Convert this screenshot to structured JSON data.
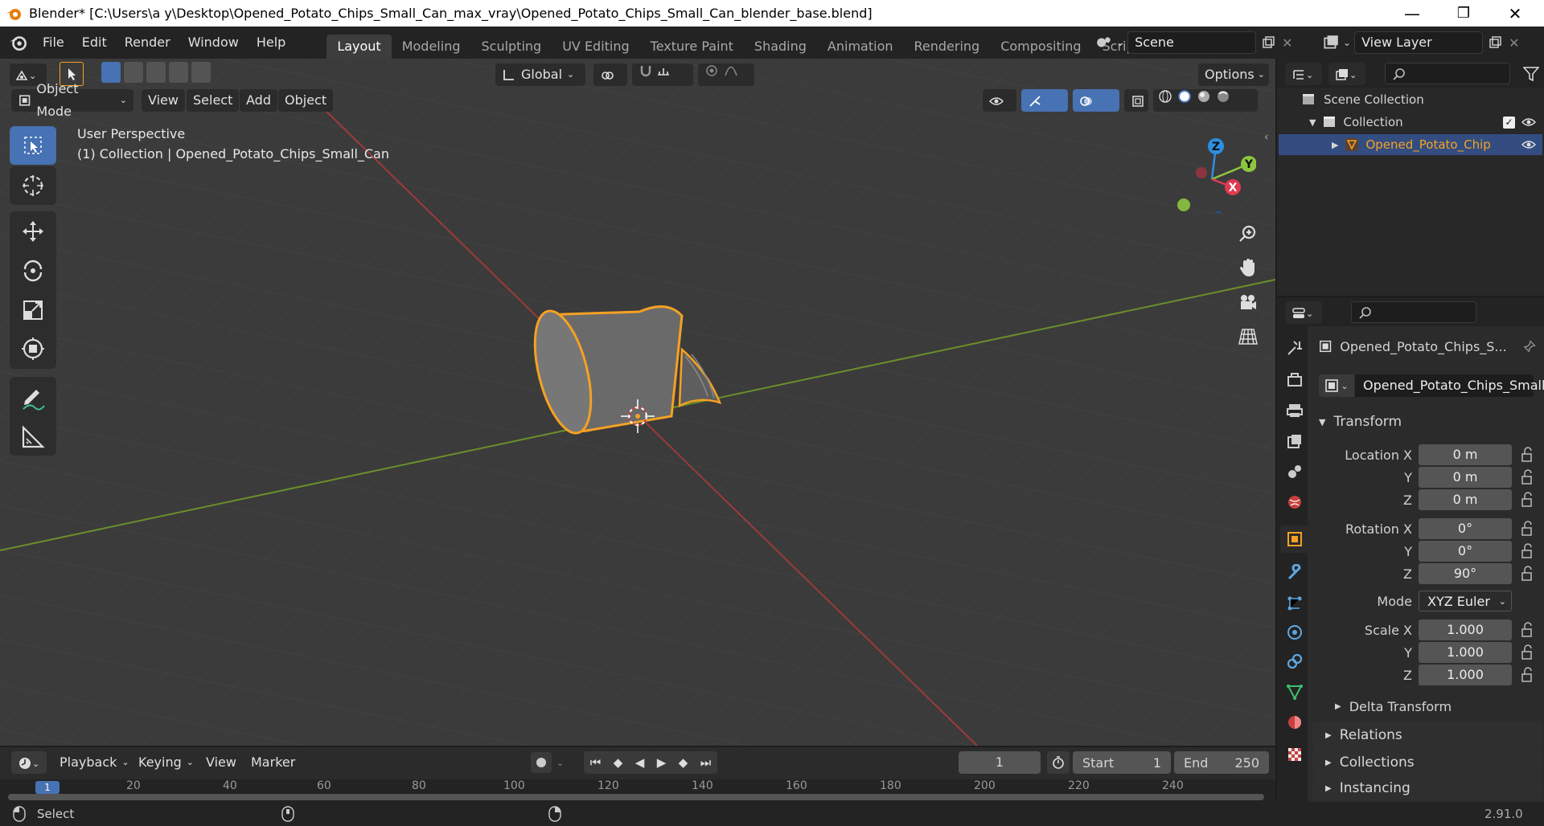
{
  "window": {
    "title": "Blender* [C:\\Users\\a y\\Desktop\\Opened_Potato_Chips_Small_Can_max_vray\\Opened_Potato_Chips_Small_Can_blender_base.blend]",
    "minimize": "—",
    "maximize": "❐",
    "close": "✕"
  },
  "menu": [
    "File",
    "Edit",
    "Render",
    "Window",
    "Help"
  ],
  "workspaces": [
    "Layout",
    "Modeling",
    "Sculpting",
    "UV Editing",
    "Texture Paint",
    "Shading",
    "Animation",
    "Rendering",
    "Compositing",
    "Scripting"
  ],
  "workspace_add": "+",
  "scene_name": "Scene",
  "view_layer": "View Layer",
  "header": {
    "transform_orientation": "Global",
    "options": "Options",
    "mode": "Object Mode",
    "menus": [
      "View",
      "Select",
      "Add",
      "Object"
    ]
  },
  "viewport": {
    "perspective": "User Perspective",
    "collection_info": "(1) Collection | Opened_Potato_Chips_Small_Can",
    "gizmo": {
      "x": "X",
      "y": "Y",
      "z": "Z"
    }
  },
  "outliner": {
    "scene_collection": "Scene Collection",
    "collection": "Collection",
    "object": "Opened_Potato_Chip"
  },
  "properties": {
    "object_name": "Opened_Potato_Chips_S...",
    "object_data": "Opened_Potato_Chips_Small...",
    "transform_title": "Transform",
    "location": {
      "label": "Location X",
      "x": "0 m",
      "y": "0 m",
      "z": "0 m"
    },
    "rotation": {
      "label": "Rotation X",
      "x": "0°",
      "y": "0°",
      "z": "90°"
    },
    "mode_label": "Mode",
    "mode_value": "XYZ Euler",
    "scale": {
      "label": "Scale X",
      "x": "1.000",
      "y": "1.000",
      "z": "1.000"
    },
    "axis_y": "Y",
    "axis_z": "Z",
    "delta_transform": "Delta Transform",
    "relations": "Relations",
    "collections": "Collections",
    "instancing": "Instancing"
  },
  "timeline": {
    "menus": [
      "Playback",
      "Keying",
      "View",
      "Marker"
    ],
    "current_frame": "1",
    "start_label": "Start",
    "start": "1",
    "end_label": "End",
    "end": "250",
    "ruler": [
      "1",
      "20",
      "40",
      "60",
      "80",
      "100",
      "120",
      "140",
      "160",
      "180",
      "200",
      "220",
      "240"
    ]
  },
  "status": {
    "select": "Select",
    "version": "2.91.0"
  },
  "colors": {
    "accent": "#4772b3",
    "selection_orange": "#f5a123",
    "x_axis": "#c8403f",
    "y_axis": "#6e9a2a"
  }
}
